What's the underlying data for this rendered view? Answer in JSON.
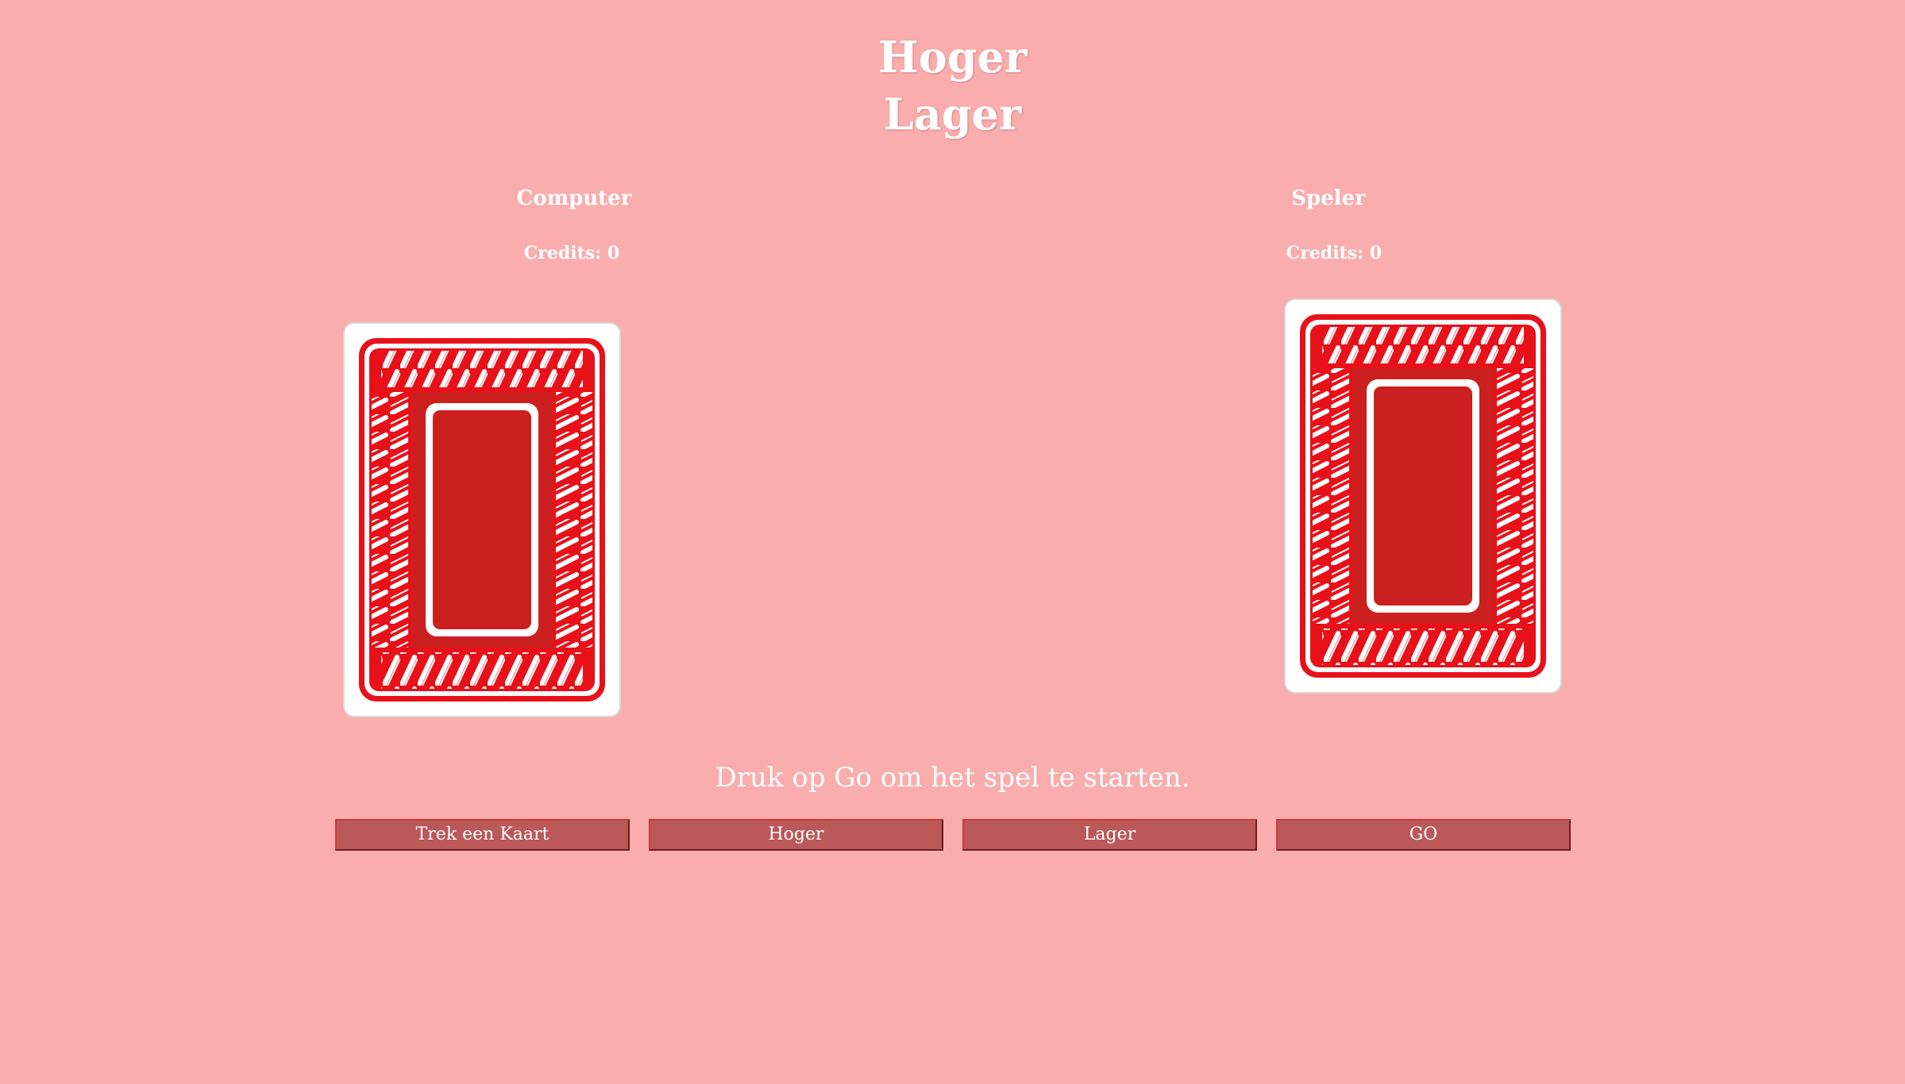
{
  "title": {
    "line1": "Hoger",
    "line2": "Lager"
  },
  "players": {
    "computer": {
      "name": "Computer",
      "credits": "Credits: 0"
    },
    "speler": {
      "name": "Speler",
      "credits": "Credits: 0"
    }
  },
  "message": "Druk op Go om het spel te starten.",
  "buttons": {
    "draw": "Trek een Kaart",
    "higher": "Hoger",
    "lower": "Lager",
    "go": "GO"
  },
  "colors": {
    "background": "#f9adad",
    "card_back": "#cc1f20",
    "card_back_accent": "#e8111a",
    "button": "#bb585a"
  }
}
